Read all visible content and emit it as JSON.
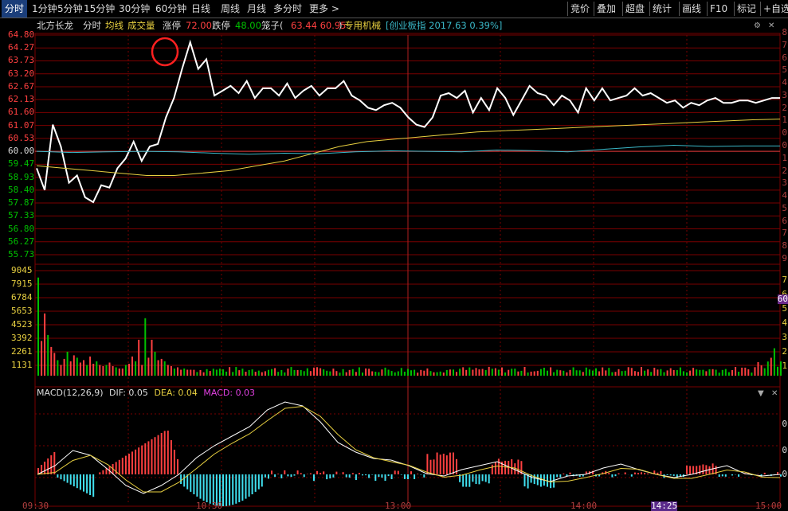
{
  "toolbar": {
    "left_items": [
      "分时",
      "1分钟",
      "5分钟",
      "15分钟",
      "30分钟",
      "60分钟",
      "日线",
      "周线",
      "月线",
      "多分时",
      "更多 >"
    ],
    "active_index": 0,
    "right_items": [
      "竞价",
      "叠加",
      "超盘",
      "统计",
      "画线",
      "F10",
      "标记",
      "+自选"
    ]
  },
  "info": {
    "stock_name": "北方长龙",
    "mode": "分时",
    "avg_line": "均线",
    "volume": "成交量",
    "limit_up_label": "涨停",
    "limit_up_value": "72.00",
    "limit_down_label": "跌停",
    "limit_down_value": "48.00",
    "pen_label": "笼子(",
    "pen_values": "63.44 60.95",
    "pen_close": ")",
    "sector": "专用机械",
    "index_text": "[创业板指 2017.63 0.39%]"
  },
  "price_axis": [
    "64.80",
    "64.27",
    "63.73",
    "63.20",
    "62.67",
    "62.13",
    "61.60",
    "61.07",
    "60.53",
    "60.00",
    "59.47",
    "58.93",
    "58.40",
    "57.87",
    "57.33",
    "56.80",
    "56.27",
    "55.73"
  ],
  "volume_axis": [
    "9045",
    "7915",
    "6784",
    "5653",
    "4523",
    "3392",
    "2261",
    "1131"
  ],
  "right_axis": [
    "8",
    "7",
    "6",
    "5",
    "4",
    "3",
    "2",
    "1",
    "0",
    "0",
    "1",
    "2",
    "3",
    "4",
    "5",
    "6",
    "7",
    "8",
    "9"
  ],
  "right_vol_axis": [
    "7",
    "6",
    "5",
    "4",
    "3",
    "2",
    "1"
  ],
  "right_vol_badge": "60",
  "macd": {
    "title": "MACD(12,26,9)",
    "dif": "DIF: 0.05",
    "dea": "DEA: 0.04",
    "macd": "MACD: 0.03"
  },
  "time_axis": [
    "09:30",
    "10:30",
    "13:00",
    "14:00",
    "14:25",
    "15:00"
  ],
  "colors": {
    "up": "#ff4040",
    "down": "#00c000",
    "grid": "#7a0000",
    "price_line": "#ffffff",
    "avg_line": "#e8d040",
    "index_line": "#3ab8c8",
    "dif_line": "#ffffff",
    "dea_line": "#e8d040",
    "macd_neg": "#40e0f0",
    "highlight_circle": "#ff2020"
  },
  "chart_data": {
    "type": "line",
    "title": "",
    "series": [
      {
        "values": [
          59.3,
          58.4,
          61.1,
          60.2,
          58.7,
          59.0,
          58.1,
          57.9,
          58.6,
          58.5,
          59.3,
          59.7,
          60.4,
          59.6,
          60.2,
          60.3,
          61.4,
          62.2,
          63.4,
          64.5,
          63.4,
          63.8,
          62.3,
          62.5,
          62.7,
          62.4,
          62.9,
          62.2,
          62.6,
          62.6,
          62.3,
          62.8,
          62.2,
          62.5,
          62.7,
          62.3,
          62.6,
          62.6,
          62.9,
          62.3,
          62.1,
          61.8,
          61.7,
          61.9,
          62.0,
          61.8,
          61.4,
          61.1,
          61.0,
          61.4,
          62.3,
          62.4,
          62.2,
          62.5,
          61.6,
          62.2,
          61.7,
          62.6,
          62.2,
          61.5,
          62.1,
          62.7,
          62.4,
          62.3,
          61.9,
          62.3,
          62.1,
          61.6,
          62.6,
          62.1,
          62.6,
          62.1,
          62.2,
          62.3,
          62.6,
          62.3,
          62.4,
          62.2,
          62.0,
          62.1,
          61.8,
          62.0,
          61.9,
          62.1,
          62.2,
          62.0,
          62.0,
          62.1,
          62.1,
          62.0,
          62.1,
          62.2,
          62.2
        ]
      },
      {
        "values": [
          59.4,
          59.3,
          59.2,
          59.1,
          59.0,
          59.0,
          59.1,
          59.2,
          59.4,
          59.6,
          59.9,
          60.2,
          60.4,
          60.5,
          60.6,
          60.7,
          60.8,
          60.85,
          60.9,
          60.95,
          61.0,
          61.05,
          61.1,
          61.15,
          61.2,
          61.25,
          61.3,
          61.33
        ]
      },
      {
        "values": [
          60.0,
          59.95,
          59.98,
          60.0,
          59.98,
          59.92,
          59.88,
          59.92,
          59.9,
          59.98,
          60.02,
          60.0,
          59.98,
          60.05,
          60.03,
          59.98,
          60.08,
          60.18,
          60.25,
          60.2,
          60.22,
          60.22
        ]
      }
    ],
    "ylim": [
      55.73,
      64.8
    ],
    "volume_ylim": [
      0,
      9045
    ],
    "macd": {
      "dif": 0.05,
      "dea": 0.04,
      "macd": 0.03
    }
  }
}
